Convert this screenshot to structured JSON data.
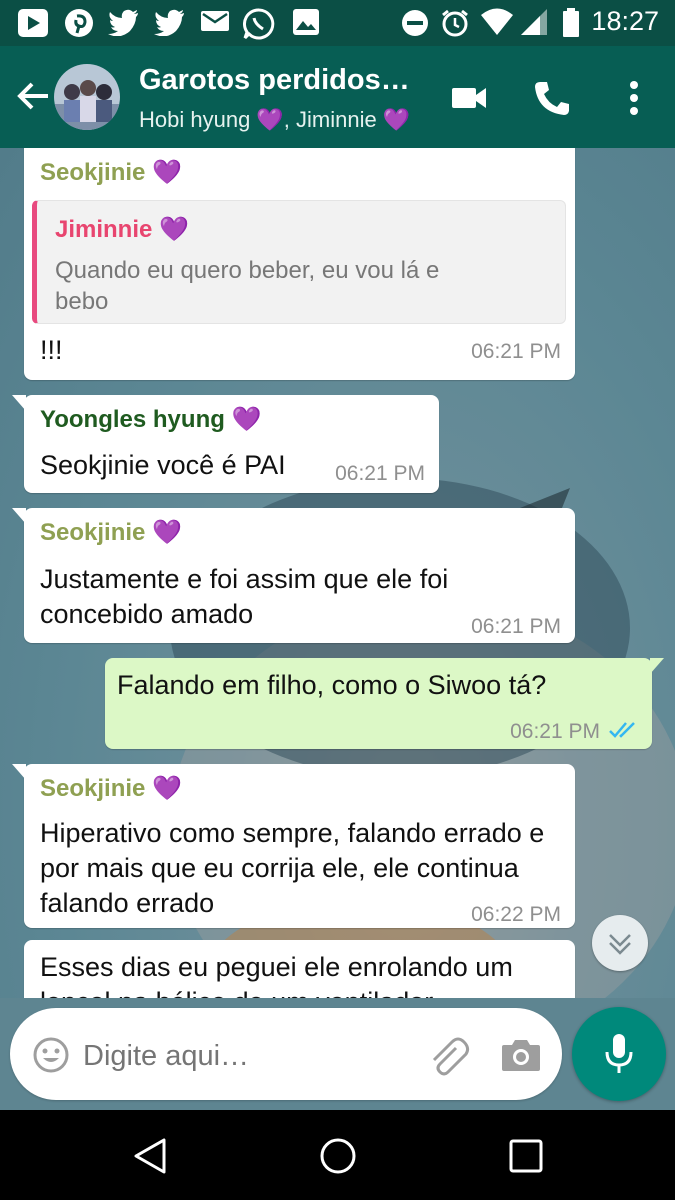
{
  "status_bar": {
    "time": "18:27",
    "left_icons": [
      "play-store-icon",
      "pinterest-icon",
      "twitter-icon",
      "twitter-icon",
      "mail-icon",
      "whatsapp-icon",
      "image-icon"
    ],
    "right_icons": [
      "do-not-disturb-icon",
      "alarm-icon",
      "wifi-icon",
      "cell-signal-icon",
      "battery-icon"
    ]
  },
  "header": {
    "title": "Garotos perdidos…",
    "subtitle": "Hobi hyung 💜, Jiminnie 💜",
    "icons": [
      "back-arrow-icon",
      "video-call-icon",
      "phone-icon",
      "more-vert-icon"
    ]
  },
  "messages": [
    {
      "sender": "Seokjinie",
      "sender_color": "#8fa052",
      "quote": {
        "name": "Jiminnie",
        "name_color": "#e8456f",
        "text": "Quando eu quero beber, eu vou lá e bebo"
      },
      "text": "!!!",
      "time": "06:21 PM"
    },
    {
      "sender": "Yoongles hyung",
      "sender_color": "#1f5b20",
      "text": "Seokjinie você é PAI",
      "time": "06:21 PM"
    },
    {
      "sender": "Seokjinie",
      "sender_color": "#8fa052",
      "text": "Justamente e foi assim que ele foi concebido amado",
      "time": "06:21 PM"
    },
    {
      "outgoing": true,
      "text": "Falando em filho, como o Siwoo tá?",
      "time": "06:21 PM",
      "read_receipt": "double-check-icon"
    },
    {
      "sender": "Seokjinie",
      "sender_color": "#8fa052",
      "text": "Hiperativo como sempre, falando errado e por mais que eu corrija ele, ele continua falando errado",
      "time": "06:22 PM"
    },
    {
      "text": "Esses dias eu peguei ele enrolando um lençol na hélice de um ventilador"
    }
  ],
  "heart": "💜",
  "composer": {
    "placeholder": "Digite aqui…",
    "icons": [
      "emoji-icon",
      "attach-icon",
      "camera-icon",
      "mic-icon"
    ]
  },
  "colors": {
    "header": "#075e54",
    "status_bar": "#0b4f45",
    "accent": "#00897b",
    "outgoing_bubble": "#dcf8c6"
  }
}
